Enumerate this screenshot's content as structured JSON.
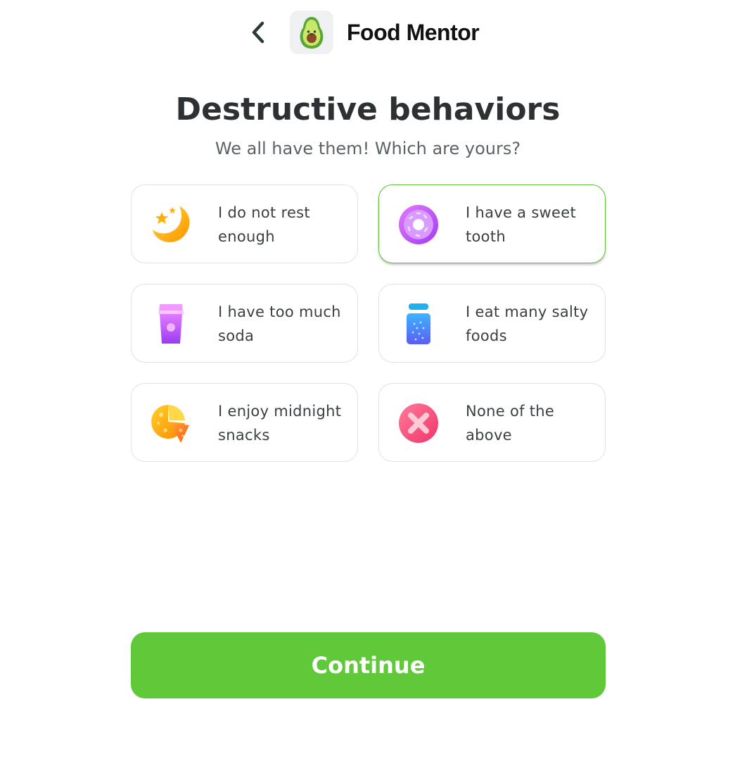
{
  "header": {
    "brand": "Food Mentor",
    "back_icon": "chevron-left-icon",
    "logo_icon": "avocado-icon"
  },
  "question": {
    "title": "Destructive behaviors",
    "subtitle": "We all have them! Which are yours?"
  },
  "options": [
    {
      "label": "I do not rest enough",
      "icon": "moon-stars-icon",
      "selected": false
    },
    {
      "label": "I have a sweet tooth",
      "icon": "donut-icon",
      "selected": true
    },
    {
      "label": "I have too much soda",
      "icon": "soda-cup-icon",
      "selected": false
    },
    {
      "label": "I eat many salty foods",
      "icon": "salt-shaker-icon",
      "selected": false
    },
    {
      "label": "I enjoy midnight snacks",
      "icon": "pizza-icon",
      "selected": false
    },
    {
      "label": "None of the above",
      "icon": "x-circle-icon",
      "selected": false
    }
  ],
  "continue_label": "Continue",
  "colors": {
    "accent": "#60c93a",
    "selected_border": "#60c13a",
    "title": "#2d3133",
    "subtitle": "#5c6366"
  }
}
